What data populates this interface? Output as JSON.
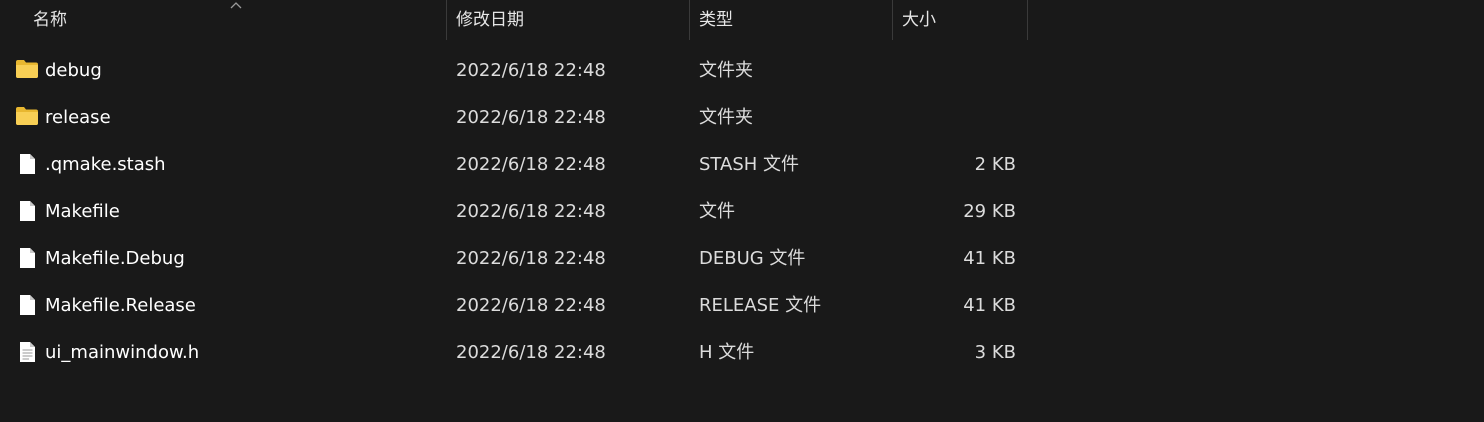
{
  "columns": {
    "name": "名称",
    "date": "修改日期",
    "type": "类型",
    "size": "大小"
  },
  "sort": {
    "column": "name",
    "direction": "ascending",
    "icon": "sort-up-chevron-icon"
  },
  "files": [
    {
      "name": "debug",
      "date": "2022/6/18 22:48",
      "type": "文件夹",
      "size": "",
      "icon": "folder-icon"
    },
    {
      "name": "release",
      "date": "2022/6/18 22:48",
      "type": "文件夹",
      "size": "",
      "icon": "folder-icon"
    },
    {
      "name": ".qmake.stash",
      "date": "2022/6/18 22:48",
      "type": "STASH 文件",
      "size": "2 KB",
      "icon": "file-icon"
    },
    {
      "name": "Makefile",
      "date": "2022/6/18 22:48",
      "type": "文件",
      "size": "29 KB",
      "icon": "file-icon"
    },
    {
      "name": "Makefile.Debug",
      "date": "2022/6/18 22:48",
      "type": "DEBUG 文件",
      "size": "41 KB",
      "icon": "file-icon"
    },
    {
      "name": "Makefile.Release",
      "date": "2022/6/18 22:48",
      "type": "RELEASE 文件",
      "size": "41 KB",
      "icon": "file-icon"
    },
    {
      "name": "ui_mainwindow.h",
      "date": "2022/6/18 22:48",
      "type": "H 文件",
      "size": "3 KB",
      "icon": "text-file-icon"
    }
  ],
  "colors": {
    "background": "#191919",
    "folder": "#f4c443",
    "text": "#ffffff",
    "divider": "#3a3a3a"
  }
}
